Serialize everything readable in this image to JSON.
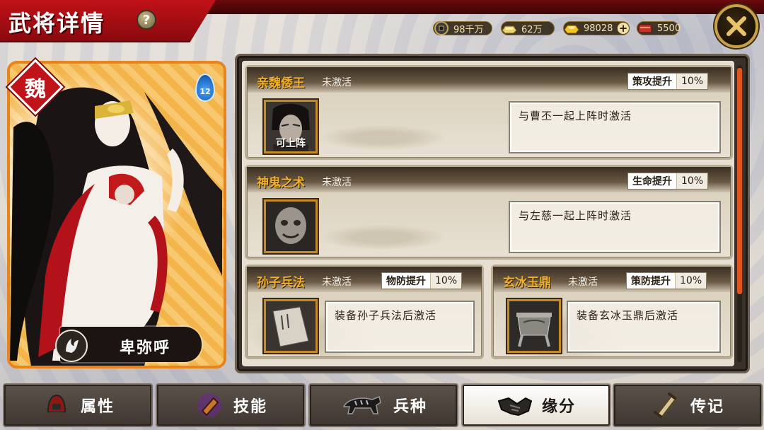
{
  "header": {
    "title": "武将详情",
    "help_label": "?"
  },
  "resources": [
    {
      "icon": "coin-icon",
      "value": "98千万"
    },
    {
      "icon": "silver-ingot-icon",
      "value": "62万"
    },
    {
      "icon": "gold-ingot-icon",
      "value": "98028"
    },
    {
      "icon": "add-icon",
      "value": "+"
    },
    {
      "icon": "token-icon",
      "value": "5500"
    }
  ],
  "close_label": "✕",
  "hero": {
    "kingdom": "魏",
    "level": "12",
    "name": "卑弥呼"
  },
  "fates": [
    {
      "name": "亲魏倭王",
      "status": "未激活",
      "bonus_label": "策攻提升",
      "bonus_value": "10%",
      "portrait_label": "可上阵",
      "condition": "与曹丕一起上阵时激活"
    },
    {
      "name": "神鬼之术",
      "status": "未激活",
      "bonus_label": "生命提升",
      "bonus_value": "10%",
      "portrait_label": "",
      "condition": "与左慈一起上阵时激活"
    },
    {
      "name": "孙子兵法",
      "status": "未激活",
      "bonus_label": "物防提升",
      "bonus_value": "10%",
      "portrait_label": "",
      "condition": "装备孙子兵法后激活"
    },
    {
      "name": "玄冰玉鼎",
      "status": "未激活",
      "bonus_label": "策防提升",
      "bonus_value": "10%",
      "portrait_label": "",
      "condition": "装备玄冰玉鼎后激活"
    }
  ],
  "nav": [
    {
      "label": "属性",
      "icon": "helmet-icon",
      "active": false
    },
    {
      "label": "技能",
      "icon": "skill-book-icon",
      "active": false
    },
    {
      "label": "兵种",
      "icon": "tiger-icon",
      "active": false
    },
    {
      "label": "缘分",
      "icon": "handshake-icon",
      "active": true
    },
    {
      "label": "传记",
      "icon": "scroll-icon",
      "active": false
    }
  ],
  "colors": {
    "title_red": "#c01218",
    "fate_gold": "#f2b02a",
    "card_orange": "#e8841c",
    "scroll_orange": "#e0551e"
  }
}
